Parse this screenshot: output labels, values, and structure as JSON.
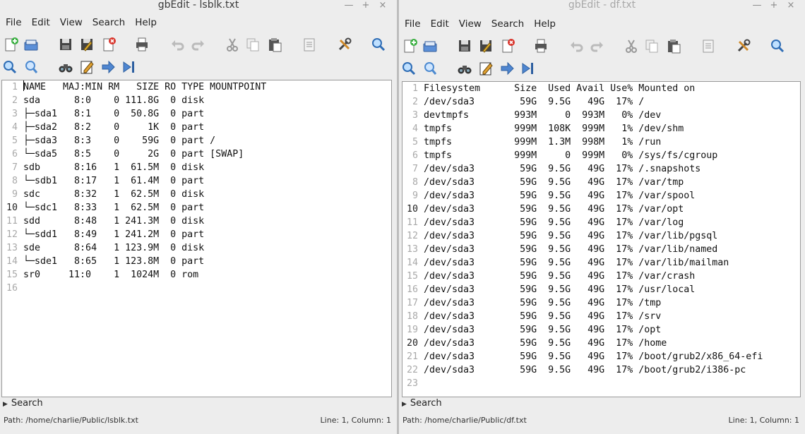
{
  "left": {
    "title": "gbEdit - lsblk.txt",
    "window_buttons": [
      "—",
      "+",
      "×"
    ],
    "menu": [
      "File",
      "Edit",
      "View",
      "Search",
      "Help"
    ],
    "lines": [
      "NAME   MAJ:MIN RM   SIZE RO TYPE MOUNTPOINT",
      "sda      8:0    0 111.8G  0 disk",
      "├─sda1   8:1    0  50.8G  0 part",
      "├─sda2   8:2    0     1K  0 part",
      "├─sda3   8:3    0    59G  0 part /",
      "└─sda5   8:5    0     2G  0 part [SWAP]",
      "sdb      8:16   1  61.5M  0 disk",
      "└─sdb1   8:17   1  61.4M  0 part",
      "sdc      8:32   1  62.5M  0 disk",
      "└─sdc1   8:33   1  62.5M  0 part",
      "sdd      8:48   1 241.3M  0 disk",
      "└─sdd1   8:49   1 241.2M  0 part",
      "sde      8:64   1 123.9M  0 disk",
      "└─sde1   8:65   1 123.8M  0 part",
      "sr0     11:0    1  1024M  0 rom",
      ""
    ],
    "search_label": "Search",
    "status_path": "Path: /home/charlie/Public/lsblk.txt",
    "status_pos": "Line: 1, Column: 1"
  },
  "right": {
    "title": "gbEdit - df.txt",
    "window_buttons": [
      "—",
      "+",
      "×"
    ],
    "menu": [
      "File",
      "Edit",
      "View",
      "Search",
      "Help"
    ],
    "lines": [
      "Filesystem      Size  Used Avail Use% Mounted on",
      "/dev/sda3        59G  9.5G   49G  17% /",
      "devtmpfs        993M     0  993M   0% /dev",
      "tmpfs           999M  108K  999M   1% /dev/shm",
      "tmpfs           999M  1.3M  998M   1% /run",
      "tmpfs           999M     0  999M   0% /sys/fs/cgroup",
      "/dev/sda3        59G  9.5G   49G  17% /.snapshots",
      "/dev/sda3        59G  9.5G   49G  17% /var/tmp",
      "/dev/sda3        59G  9.5G   49G  17% /var/spool",
      "/dev/sda3        59G  9.5G   49G  17% /var/opt",
      "/dev/sda3        59G  9.5G   49G  17% /var/log",
      "/dev/sda3        59G  9.5G   49G  17% /var/lib/pgsql",
      "/dev/sda3        59G  9.5G   49G  17% /var/lib/named",
      "/dev/sda3        59G  9.5G   49G  17% /var/lib/mailman",
      "/dev/sda3        59G  9.5G   49G  17% /var/crash",
      "/dev/sda3        59G  9.5G   49G  17% /usr/local",
      "/dev/sda3        59G  9.5G   49G  17% /tmp",
      "/dev/sda3        59G  9.5G   49G  17% /srv",
      "/dev/sda3        59G  9.5G   49G  17% /opt",
      "/dev/sda3        59G  9.5G   49G  17% /home",
      "/dev/sda3        59G  9.5G   49G  17% /boot/grub2/x86_64-efi",
      "/dev/sda3        59G  9.5G   49G  17% /boot/grub2/i386-pc",
      ""
    ],
    "search_label": "Search",
    "status_path": "Path: /home/charlie/Public/df.txt",
    "status_pos": "Line: 1, Column: 1"
  },
  "toolbar_icons_row1": [
    "new-file-icon",
    "open-icon",
    "save-icon",
    "save-as-icon",
    "close-file-icon",
    "print-icon",
    "undo-icon",
    "redo-icon",
    "cut-icon",
    "copy-icon",
    "paste-icon",
    "document-properties-icon",
    "preferences-icon",
    "zoom-icon"
  ],
  "toolbar_icons_row2": [
    "find-icon",
    "find-next-icon",
    "binoculars-icon",
    "edit-icon",
    "forward-arrow-icon",
    "goto-end-icon"
  ]
}
